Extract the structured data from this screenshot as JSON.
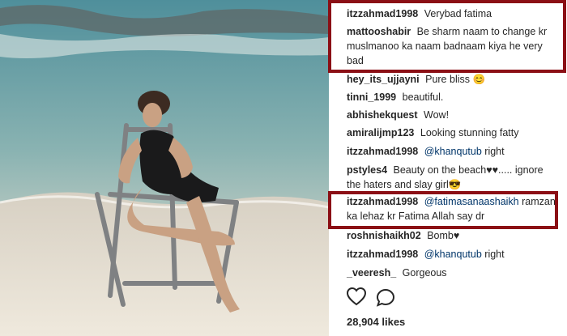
{
  "comments": [
    {
      "user": "itzzahmad1998",
      "text": "Verybad fatima"
    },
    {
      "user": "mattooshabir",
      "text": "Be sharm naam to change kr muslmanoo ka naam badnaam kiya he very bad"
    },
    {
      "user": "hey_its_ujjayni",
      "text": "Pure bliss 😊"
    },
    {
      "user": "tinni_1999",
      "text": "beautiful."
    },
    {
      "user": "abhishekquest",
      "text": "Wow!"
    },
    {
      "user": "amiralijmp123",
      "text": "Looking stunning fatty"
    },
    {
      "user": "itzzahmad1998",
      "mention": "@khanqutub",
      "text": "right"
    },
    {
      "user": "pstyles4",
      "text": "Beauty on the beach♥♥..... ignore the haters and slay girl😎"
    },
    {
      "user": "itzzahmad1998",
      "mention": "@fatimasanaashaikh",
      "text": "ramzan ka lehaz kr Fatima Allah say dr"
    },
    {
      "user": "roshnishaikh02",
      "text": "Bomb♥"
    },
    {
      "user": "itzzahmad1998",
      "mention": "@khanqutub",
      "text": "right"
    },
    {
      "user": "_veeresh_",
      "text": "Gorgeous"
    }
  ],
  "likes": "28,904 likes",
  "highlight_color": "#8b0f15",
  "icons": [
    "heart-icon",
    "comment-icon"
  ]
}
